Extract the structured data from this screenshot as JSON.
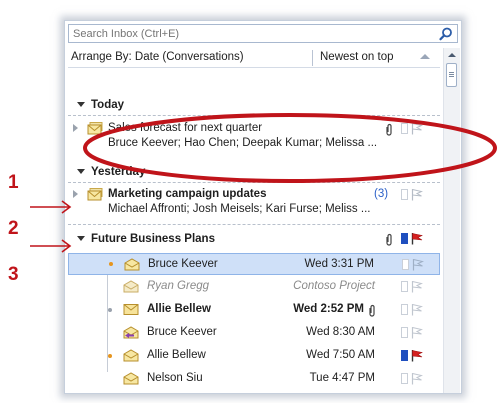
{
  "search": {
    "placeholder": "Search Inbox (Ctrl+E)"
  },
  "arrange": {
    "label": "Arrange By: Date (Conversations)",
    "order": "Newest on top"
  },
  "groups": {
    "today": "Today",
    "yesterday": "Yesterday"
  },
  "conversations": [
    {
      "subject": "Sales forecast for next quarter",
      "participants": "Bruce Keever; Hao Chen; Deepak Kumar; Melissa ..."
    },
    {
      "subject": "Marketing campaign updates",
      "count": "(3)",
      "participants": "Michael Affronti; Josh Meisels; Kari Furse; Meliss ..."
    }
  ],
  "expanded_conversation": {
    "subject": "Future Business Plans",
    "items": [
      {
        "name": "Bruce Keever",
        "time": "Wed 3:31 PM"
      },
      {
        "name": "Ryan Gregg",
        "time": "Contoso Project"
      },
      {
        "name": "Allie Bellew",
        "time": "Wed 2:52 PM"
      },
      {
        "name": "Bruce Keever",
        "time": "Wed 8:30 AM"
      },
      {
        "name": "Allie Bellew",
        "time": "Wed 7:50 AM"
      },
      {
        "name": "Nelson Siu",
        "time": "Tue 4:47 PM"
      }
    ]
  },
  "annotations": [
    "1",
    "2",
    "3"
  ],
  "colors": {
    "accent_red": "#c0141a",
    "selection": "#cfe0f8",
    "count_blue": "#2a5fc8",
    "flag_red": "#d42020",
    "category_blue": "#1f4fbf"
  }
}
